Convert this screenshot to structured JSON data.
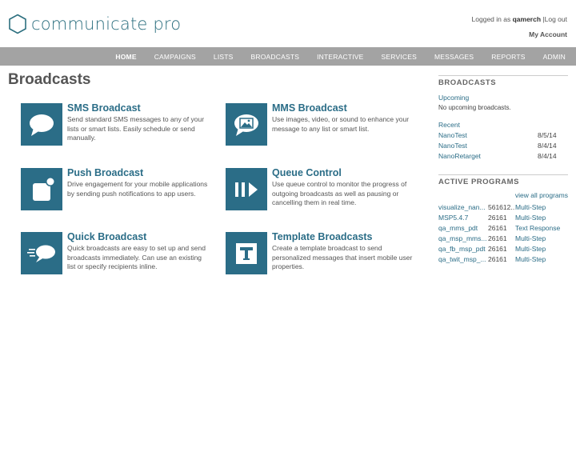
{
  "header": {
    "logo_text": "communicate pro",
    "logged_in_prefix": "Logged in as",
    "username": "qamerch",
    "separator": "|",
    "logout": "Log out",
    "my_account": "My Account"
  },
  "nav": {
    "items": [
      "HOME",
      "CAMPAIGNS",
      "LISTS",
      "BROADCASTS",
      "INTERACTIVE",
      "SERVICES",
      "MESSAGES",
      "REPORTS",
      "ADMIN"
    ]
  },
  "page": {
    "title": "Broadcasts"
  },
  "cards": [
    {
      "title": "SMS Broadcast",
      "icon": "chat-bubble-icon",
      "desc": "Send standard SMS messages to any of your lists or smart lists. Easily schedule or send manually."
    },
    {
      "title": "MMS Broadcast",
      "icon": "image-bubble-icon",
      "desc": "Use images, video, or sound to enhance your message to any list or smart list."
    },
    {
      "title": "Push Broadcast",
      "icon": "push-notification-icon",
      "desc": "Drive engagement for your mobile applications by sending push notifications to app users."
    },
    {
      "title": "Queue Control",
      "icon": "pause-play-icon",
      "desc": "Use queue control to monitor the progress of outgoing broadcasts as well as pausing or cancelling them in real time."
    },
    {
      "title": "Quick Broadcast",
      "icon": "fast-bubble-icon",
      "desc": "Quick broadcasts are easy to set up and send broadcasts immediately. Can use an existing list or specify recipients inline."
    },
    {
      "title": "Template Broadcasts",
      "icon": "template-t-icon",
      "desc": "Create a template broadcast to send personalized messages that insert mobile user properties."
    }
  ],
  "sidebar": {
    "broadcasts_heading": "BROADCASTS",
    "upcoming_label": "Upcoming",
    "upcoming_empty": "No upcoming broadcasts.",
    "recent_label": "Recent",
    "recent": [
      {
        "name": "NanoTest",
        "date": "8/5/14"
      },
      {
        "name": "NanoTest",
        "date": "8/4/14"
      },
      {
        "name": "NanoRetarget",
        "date": "8/4/14"
      }
    ],
    "programs_heading": "ACTIVE PROGRAMS",
    "view_all": "view all programs",
    "programs": [
      {
        "name": "visualize_nan...",
        "id": "561612...",
        "type": "Multi-Step"
      },
      {
        "name": "MSP5.4.7",
        "id": "26161",
        "type": "Multi-Step"
      },
      {
        "name": "qa_mms_pdt",
        "id": "26161",
        "type": "Text Response"
      },
      {
        "name": "qa_msp_mms...",
        "id": "26161",
        "type": "Multi-Step"
      },
      {
        "name": "qa_fb_msp_pdt",
        "id": "26161",
        "type": "Multi-Step"
      },
      {
        "name": "qa_twit_msp_...",
        "id": "26161",
        "type": "Multi-Step"
      }
    ]
  },
  "colors": {
    "accent": "#2b6d87",
    "nav_bg": "#a3a3a3",
    "logo": "#2c6f7f"
  }
}
